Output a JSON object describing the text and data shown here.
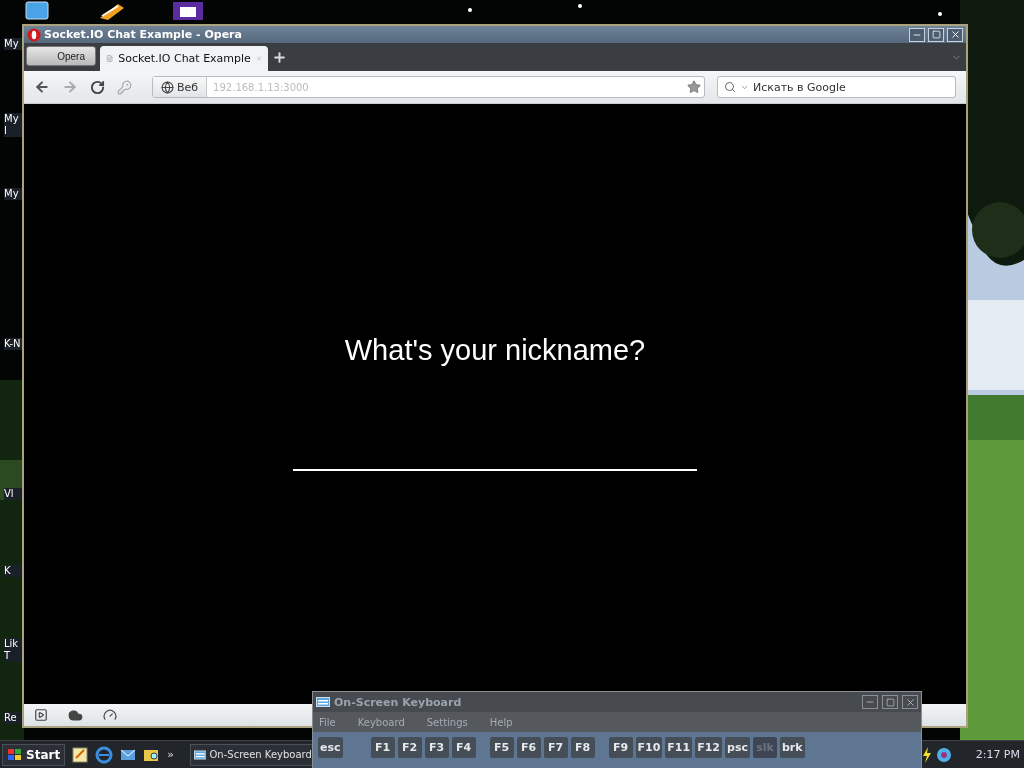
{
  "desktop": {
    "icon_labels": [
      "My",
      "My I",
      "My",
      "K-N",
      "Vl",
      "K",
      "Lik T",
      "Re"
    ]
  },
  "browser": {
    "title": "Socket.IO Chat Example - Opera",
    "menu_button": "Opera",
    "tabs": [
      {
        "label": "Socket.IO Chat Example",
        "selected": true
      }
    ],
    "address": {
      "badge": "Веб",
      "value": "192.168.1.13:3000"
    },
    "search": {
      "placeholder": "Искать в Google"
    },
    "page": {
      "heading": "What's your nickname?"
    }
  },
  "keyboard": {
    "title": "On-Screen Keyboard",
    "menu": [
      "File",
      "Keyboard",
      "Settings",
      "Help"
    ],
    "key_groups": [
      [
        {
          "label": "esc",
          "dimmed": false
        }
      ],
      [
        {
          "label": "F1",
          "dimmed": false
        },
        {
          "label": "F2",
          "dimmed": false
        },
        {
          "label": "F3",
          "dimmed": false
        },
        {
          "label": "F4",
          "dimmed": false
        }
      ],
      [
        {
          "label": "F5",
          "dimmed": false
        },
        {
          "label": "F6",
          "dimmed": false
        },
        {
          "label": "F7",
          "dimmed": false
        },
        {
          "label": "F8",
          "dimmed": false
        }
      ],
      [
        {
          "label": "F9",
          "dimmed": false
        },
        {
          "label": "F10",
          "dimmed": false
        },
        {
          "label": "F11",
          "dimmed": false
        },
        {
          "label": "F12",
          "dimmed": false
        },
        {
          "label": "psc",
          "dimmed": false
        },
        {
          "label": "slk",
          "dimmed": true
        },
        {
          "label": "brk",
          "dimmed": false
        }
      ]
    ]
  },
  "taskbar": {
    "start": "Start",
    "overflow": "»",
    "tasks": [
      {
        "label": "On-Screen Keyboard",
        "selected": false
      }
    ],
    "clock": "2:17 PM"
  }
}
